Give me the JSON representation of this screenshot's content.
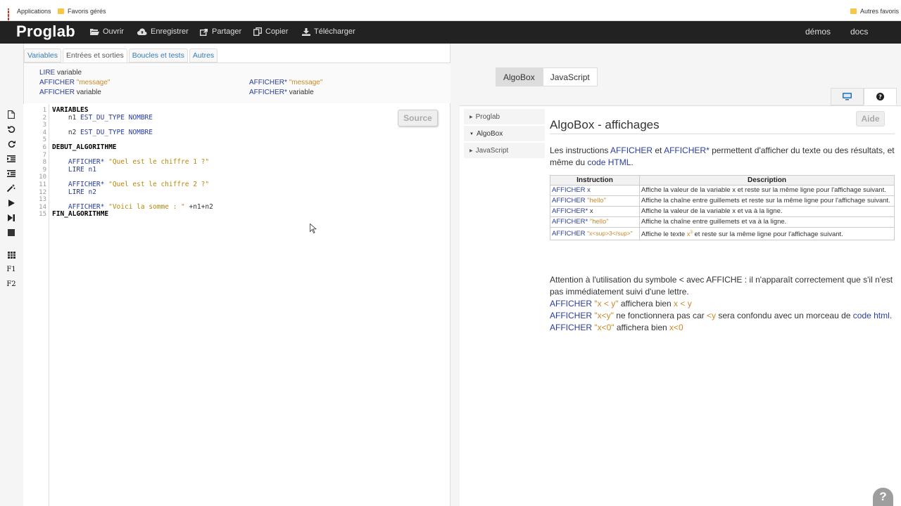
{
  "bookmarks": {
    "apps": "Applications",
    "fav": "Favoris gérés",
    "others": "Autres favoris"
  },
  "navbar": {
    "brand": "Proglab",
    "items": [
      "Ouvrir",
      "Enregistrer",
      "Partager",
      "Copier",
      "Télécharger"
    ],
    "right": [
      "démos",
      "docs"
    ]
  },
  "tabs": [
    "Variables",
    "Entrées et sorties",
    "Boucles et tests",
    "Autres"
  ],
  "snippets": {
    "lire_kw": "LIRE",
    "lire_arg": "variable",
    "aff1_kw": "AFFICHER",
    "aff1_arg": "\"message\"",
    "aff2_kw": "AFFICHER",
    "aff2_arg": "variable",
    "aff3_kw": "AFFICHER*",
    "aff3_arg": "\"message\"",
    "aff4_kw": "AFFICHER*",
    "aff4_arg": "variable"
  },
  "editor": {
    "source_button": "Source",
    "line_numbers": [
      "1",
      "2",
      "3",
      "4",
      "5",
      "6",
      "7",
      "8",
      "9",
      "10",
      "11",
      "12",
      "13",
      "14",
      "15"
    ],
    "toolbar_f1": "F1",
    "toolbar_f2": "F2"
  },
  "right": {
    "lang_tabs": [
      "AlgoBox",
      "JavaScript"
    ],
    "side_menu": [
      "Proglab",
      "AlgoBox",
      "JavaScript"
    ],
    "aide_button": "Aide",
    "title": "AlgoBox - affichages",
    "intro": {
      "t1": "Les instructions ",
      "k1": "AFFICHER",
      "t2": " et ",
      "k2": "AFFICHER*",
      "t3": " permettent d'afficher du texte ou des résultats, et même du ",
      "link": "code HTML",
      "t4": "."
    },
    "table": {
      "headers": [
        "Instruction",
        "Description"
      ],
      "rows": [
        {
          "kw": "AFFICHER",
          "arg": "x",
          "desc": "Affiche la valeur de la variable x et reste sur la même ligne pour l'affichage suivant."
        },
        {
          "kw": "AFFICHER",
          "arg": "\"hello\"",
          "desc": "Affiche la chaîne entre guillemets et reste sur la même ligne pour l'affichage suivant."
        },
        {
          "kw": "AFFICHER*",
          "arg": "x",
          "desc": "Affiche la valeur de la variable x et va à la ligne."
        },
        {
          "kw": "AFFICHER*",
          "arg": "\"hello\"",
          "desc": "Affiche la chaîne entre guillemets et va à la ligne."
        },
        {
          "kw": "AFFICHER",
          "arg": "\"x<sup>3</sup>\"",
          "desc_a": "Affiche le texte ",
          "desc_x": "x",
          "desc_sup": "3",
          "desc_b": " et reste sur la même ligne pour l'affichage suivant."
        }
      ]
    },
    "warning": {
      "p1": "Attention à l'utilisation du symbole < avec AFFICHE : il n'apparaît correctement que s'il n'est pas immédiatement suivi d'une lettre.",
      "l1_kw": "AFFICHER",
      "l1_arg": "\"x < y\"",
      "l1_t": " affichera bien ",
      "l1_res": "x < y",
      "l2_kw": "AFFICHER",
      "l2_arg": "\"x<y\"",
      "l2_t1": " ne fonctionnera pas car ",
      "l2_res": "<y",
      "l2_t2": " sera confondu avec un morceau de ",
      "l2_link": "code html",
      "l2_t3": ".",
      "l3_kw": "AFFICHER",
      "l3_arg": "\"x<0\"",
      "l3_t": " affichera bien ",
      "l3_res": "x<0"
    },
    "help_fab": "?"
  }
}
